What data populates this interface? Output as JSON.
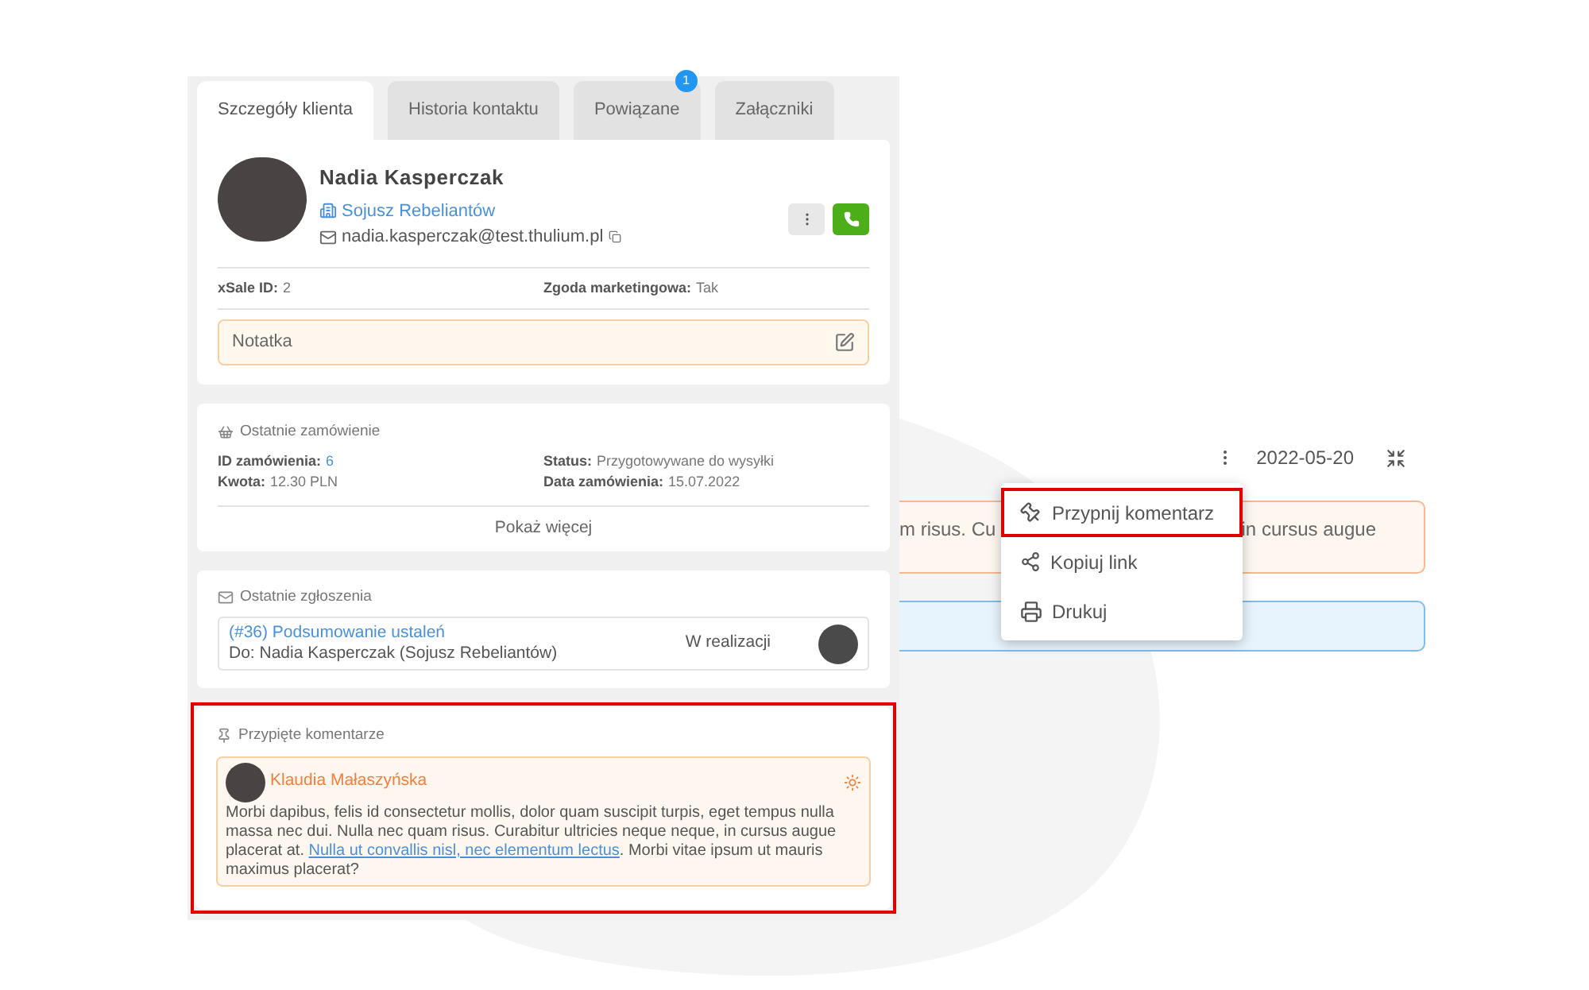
{
  "tabs": [
    {
      "label": "Szczegóły klienta",
      "selected": true
    },
    {
      "label": "Historia kontaktu",
      "selected": false
    },
    {
      "label": "Powiązane",
      "selected": false,
      "badge": "1"
    },
    {
      "label": "Załączniki",
      "selected": false
    }
  ],
  "client": {
    "name": "Nadia Kasperczak",
    "company": "Sojusz Rebeliantów",
    "email": "nadia.kasperczak@test.thulium.pl",
    "fields": [
      {
        "label": "xSale ID:",
        "value": "2"
      },
      {
        "label": "Zgoda marketingowa:",
        "value": "Tak"
      }
    ],
    "note": "Notatka"
  },
  "last_order": {
    "title": "Ostatnie zamówienie",
    "fields": [
      {
        "label": "ID zamówienia:",
        "value": "6",
        "kind": "link"
      },
      {
        "label": "Status:",
        "value": "Przygotowywane do wysyłki",
        "kind": "text"
      },
      {
        "label": "Kwota:",
        "value": "12.30 PLN",
        "kind": "text"
      },
      {
        "label": "Data zamówienia:",
        "value": "15.07.2022",
        "kind": "text"
      }
    ],
    "more": "Pokaż więcej"
  },
  "last_tickets": {
    "title": "Ostatnie zgłoszenia",
    "tickets": [
      {
        "title": "(#36) Podsumowanie ustaleń",
        "recipient": "Do: Nadia Kasperczak (Sojusz Rebeliantów)",
        "status": "W realizacji"
      }
    ]
  },
  "pinned": {
    "title": "Przypięte komentarze",
    "highlighted": true,
    "comments": [
      {
        "author": "Klaudia Małaszyńska",
        "text_before": "Morbi dapibus, felis id consectetur mollis, dolor quam suscipit turpis, eget tempus nulla massa nec dui. Nulla nec quam risus. Curabitur ultricies neque neque, in cursus augue placerat at.",
        "link": "Nulla ut convallis nisl, nec elementum lectus",
        "text_after": ". Morbi vitae ipsum ut mauris maximus placerat?"
      }
    ]
  },
  "comment_view": {
    "date": "2022-05-20",
    "fragments": [
      "m risus. Cu",
      "in cursus augue"
    ]
  },
  "menu": [
    {
      "label": "Przypnij komentarz",
      "kind": "pin",
      "highlighted": true
    },
    {
      "label": "Kopiuj link",
      "kind": "share",
      "highlighted": false
    },
    {
      "label": "Drukuj",
      "kind": "print",
      "highlighted": false
    }
  ]
}
